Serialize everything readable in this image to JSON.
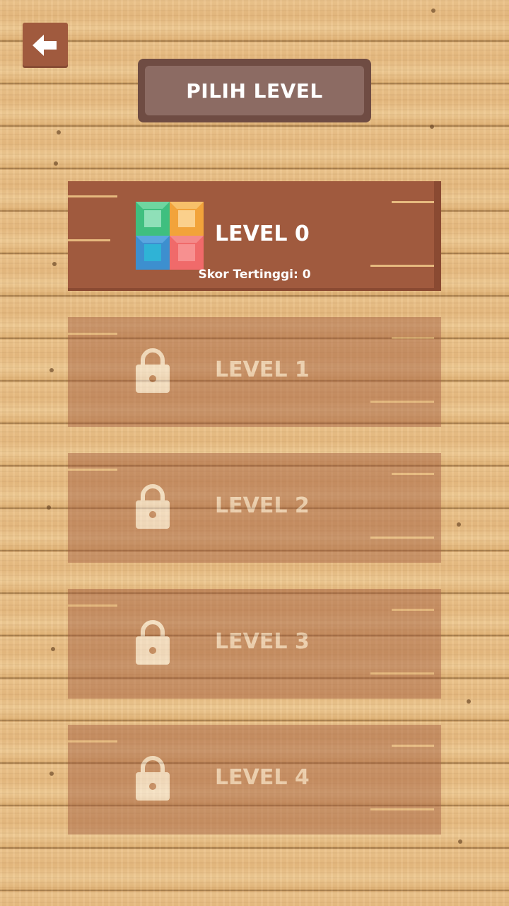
{
  "header": {
    "back_icon": "arrow-left-icon",
    "title": "PILIH LEVEL"
  },
  "levels": [
    {
      "label": "LEVEL 0",
      "locked": false,
      "icon": "color-blocks-icon",
      "score_text": "Skor Tertinggi: 0"
    },
    {
      "label": "LEVEL 1",
      "locked": true,
      "icon": "lock-icon"
    },
    {
      "label": "LEVEL 2",
      "locked": true,
      "icon": "lock-icon"
    },
    {
      "label": "LEVEL 3",
      "locked": true,
      "icon": "lock-icon"
    },
    {
      "label": "LEVEL 4",
      "locked": true,
      "icon": "lock-icon"
    }
  ],
  "colors": {
    "board": "#a05a3e",
    "title_bg": "#8c6b63",
    "title_border": "#6f4c43",
    "block_green": "#3fbf7f",
    "block_orange": "#f2a33a",
    "block_blue": "#3d8fcf",
    "block_red": "#f06a6a"
  }
}
